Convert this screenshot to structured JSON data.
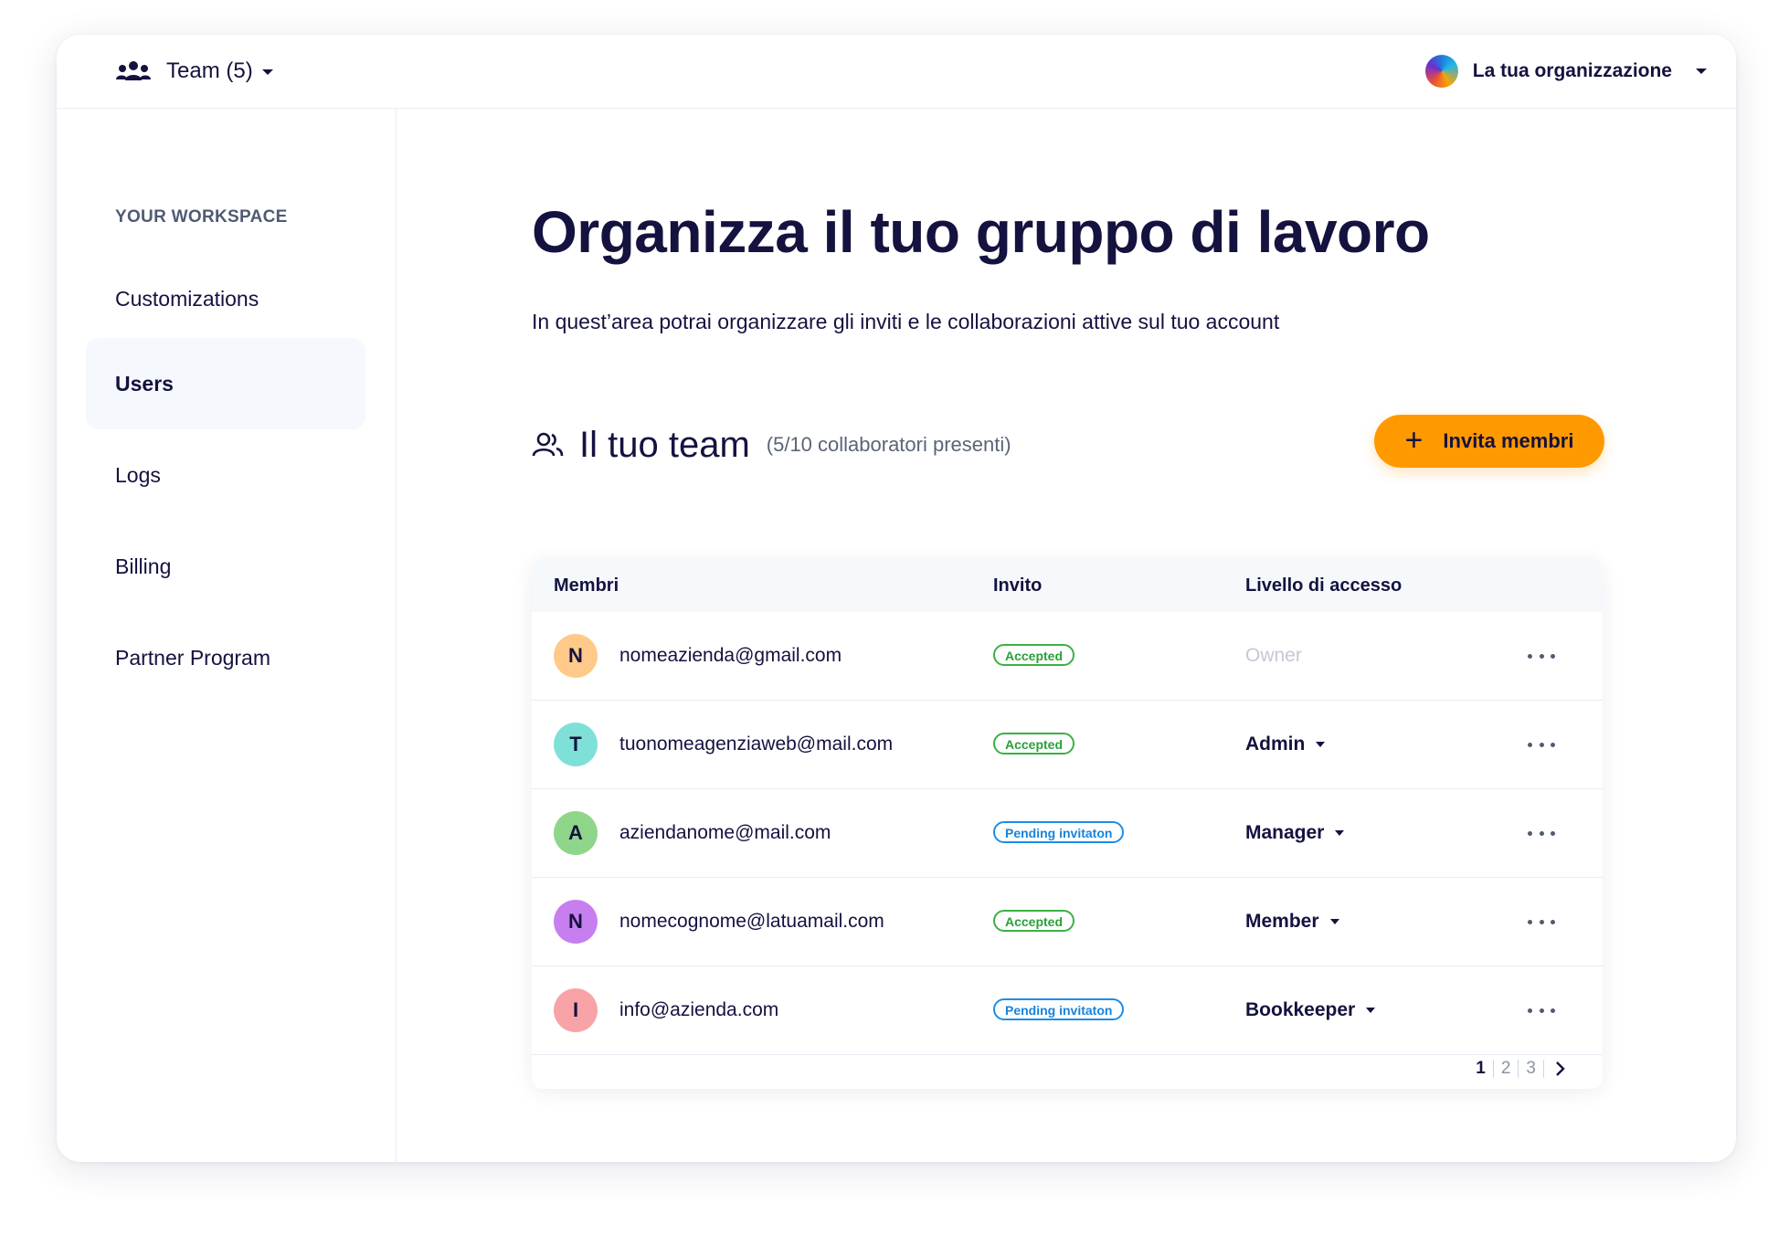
{
  "topbar": {
    "team_label": "Team (5)",
    "org_name": "La tua organizzazione"
  },
  "sidebar": {
    "heading": "YOUR WORKSPACE",
    "items": [
      {
        "label": "Customizations",
        "active": false
      },
      {
        "label": "Users",
        "active": true
      },
      {
        "label": "Logs",
        "active": false
      },
      {
        "label": "Billing",
        "active": false
      },
      {
        "label": "Partner Program",
        "active": false
      }
    ]
  },
  "main": {
    "title": "Organizza il tuo gruppo di lavoro",
    "subtitle": "In quest’area potrai organizzare gli inviti e le collaborazioni attive sul tuo account",
    "section_title": "Il tuo team",
    "section_count": "(5/10 collaboratori presenti)",
    "invite_button": "Invita membri"
  },
  "table": {
    "headers": {
      "members": "Membri",
      "invite": "Invito",
      "access": "Livello di accesso"
    },
    "rows": [
      {
        "initial": "N",
        "avatar_color": "#ffc98a",
        "email": "nomeazienda@gmail.com",
        "status": "Accepted",
        "status_type": "accepted",
        "access": "Owner",
        "editable": false
      },
      {
        "initial": "T",
        "avatar_color": "#7fe0d8",
        "email": "tuonomeagenziaweb@mail.com",
        "status": "Accepted",
        "status_type": "accepted",
        "access": "Admin",
        "editable": true
      },
      {
        "initial": "A",
        "avatar_color": "#8fd68a",
        "email": "aziendanome@mail.com",
        "status": "Pending invitaton",
        "status_type": "pending",
        "access": "Manager",
        "editable": true
      },
      {
        "initial": "N",
        "avatar_color": "#c77ff0",
        "email": "nomecognome@latuamail.com",
        "status": "Accepted",
        "status_type": "accepted",
        "access": "Member",
        "editable": true
      },
      {
        "initial": "I",
        "avatar_color": "#f8a3a8",
        "email": "info@azienda.com",
        "status": "Pending invitaton",
        "status_type": "pending",
        "access": "Bookkeeper",
        "editable": true
      }
    ],
    "pagination": {
      "pages": [
        "1",
        "2",
        "3"
      ],
      "current": "1"
    }
  },
  "colors": {
    "accent": "#ff9900",
    "text": "#14123f",
    "accepted": "#3cb043",
    "pending": "#1c8de8"
  }
}
